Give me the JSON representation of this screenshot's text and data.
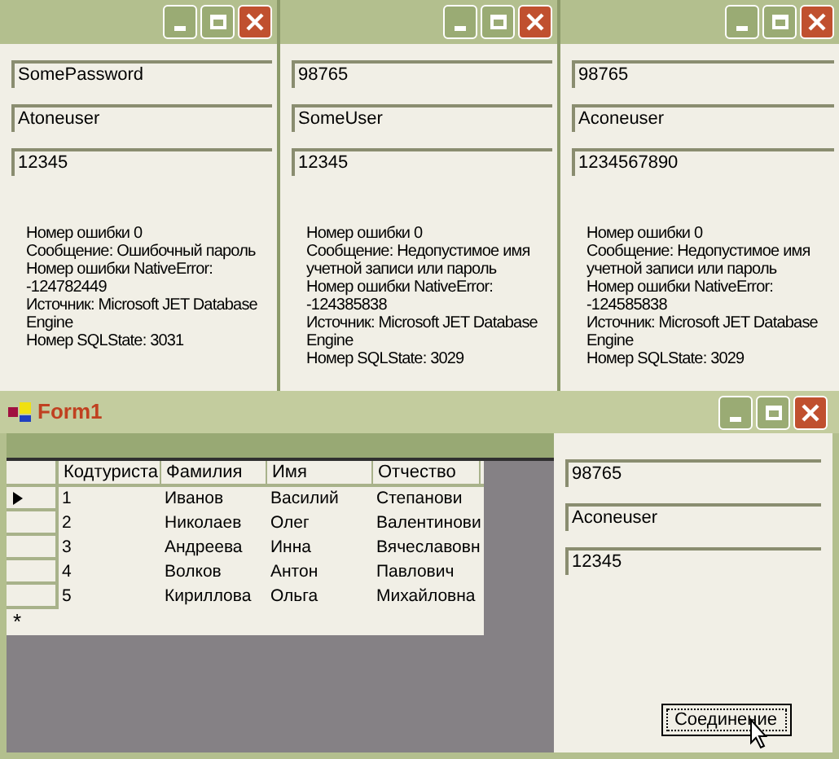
{
  "windows": [
    {
      "fields": [
        "SomePassword",
        "Atoneuser",
        "12345"
      ],
      "messages": [
        "Номер ошибки 0",
        "Сообщение: Ошибочный пароль",
        "Номер ошибки NativeError: -124782449",
        "Источник: Microsoft JET Database Engine",
        "Номер SQLState: 3031"
      ]
    },
    {
      "fields": [
        "98765",
        "SomeUser",
        "12345"
      ],
      "messages": [
        "Номер ошибки 0",
        "Сообщение: Недопустимое имя учетной записи или пароль",
        "Номер ошибки NativeError: -124385838",
        "Источник: Microsoft JET Database Engine",
        "Номер SQLState: 3029"
      ]
    },
    {
      "fields": [
        "98765",
        "Aconeuser",
        "1234567890"
      ],
      "messages": [
        "Номер ошибки 0",
        "Сообщение: Недопустимое имя учетной записи или пароль",
        "Номер ошибки NativeError: -124585838",
        "Источник: Microsoft JET Database Engine",
        "Номер SQLState: 3029"
      ]
    }
  ],
  "form": {
    "title": "Form1",
    "grid": {
      "columns": [
        "Кодтуриста",
        "Фамилия",
        "Имя",
        "Отчество"
      ],
      "rows": [
        {
          "selected": true,
          "cells": [
            "1",
            "Иванов",
            "Василий",
            "Степанови"
          ]
        },
        {
          "selected": false,
          "cells": [
            "2",
            "Николаев",
            "Олег",
            "Валентинови"
          ]
        },
        {
          "selected": false,
          "cells": [
            "3",
            "Андреева",
            "Инна",
            "Вячеславовн"
          ]
        },
        {
          "selected": false,
          "cells": [
            "4",
            "Волков",
            "Антон",
            "Павлович"
          ]
        },
        {
          "selected": false,
          "cells": [
            "5",
            "Кириллова",
            "Ольга",
            "Михайловна"
          ]
        }
      ],
      "new_row_marker": "*"
    },
    "fields": [
      "98765",
      "Aconeuser",
      "12345"
    ],
    "button": "Соединение"
  }
}
